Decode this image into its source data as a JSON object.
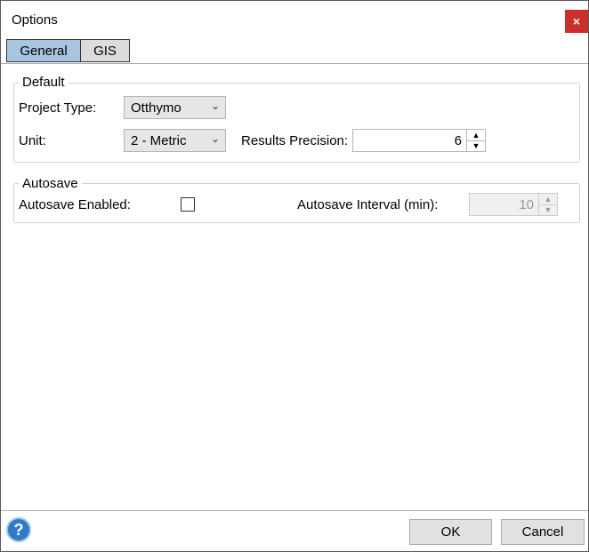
{
  "window": {
    "title": "Options",
    "close_label": "×"
  },
  "tabs": [
    {
      "label": "General",
      "active": true
    },
    {
      "label": "GIS",
      "active": false
    }
  ],
  "default_group": {
    "title": "Default",
    "project_type_label": "Project Type:",
    "project_type_value": "Otthymo",
    "unit_label": "Unit:",
    "unit_value": "2 - Metric",
    "precision_label": "Results Precision:",
    "precision_value": "6"
  },
  "autosave_group": {
    "title": "Autosave",
    "enabled_label": "Autosave Enabled:",
    "enabled_checked": false,
    "interval_label": "Autosave Interval (min):",
    "interval_value": "10"
  },
  "footer": {
    "help_label": "?",
    "ok_label": "OK",
    "cancel_label": "Cancel"
  },
  "icons": {
    "chevron": "chevron-down-icon",
    "spin_up": "triangle-up-icon",
    "spin_down": "triangle-down-icon"
  },
  "colors": {
    "active_tab": "#a8c4e0",
    "close": "#c9302c",
    "help": "#2f7bc9"
  }
}
